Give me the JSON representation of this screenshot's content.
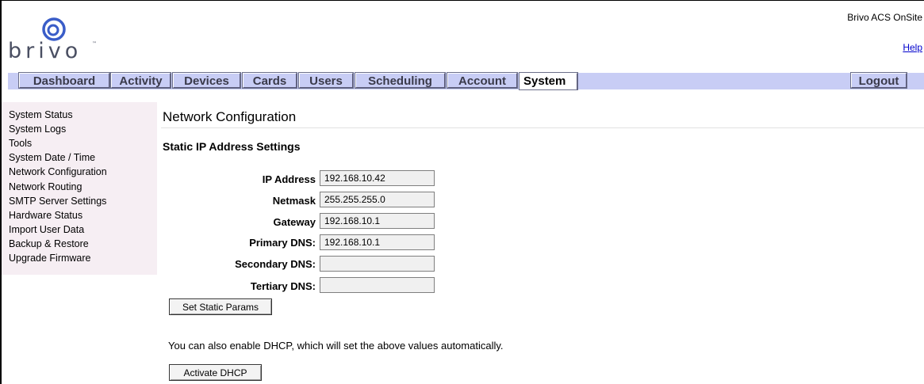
{
  "header": {
    "logo_text": "brivo",
    "logo_tm": "™",
    "product_name": "Brivo ACS OnSite",
    "help_link": "Help"
  },
  "nav": {
    "tabs": [
      {
        "label": "Dashboard"
      },
      {
        "label": "Activity"
      },
      {
        "label": "Devices"
      },
      {
        "label": "Cards"
      },
      {
        "label": "Users"
      },
      {
        "label": "Scheduling"
      },
      {
        "label": "Account"
      },
      {
        "label": "System",
        "active": true
      }
    ],
    "logout": "Logout"
  },
  "sidebar": {
    "items": [
      {
        "label": "System Status"
      },
      {
        "label": "System Logs"
      },
      {
        "label": "Tools"
      },
      {
        "label": "System Date / Time"
      },
      {
        "label": "Network Configuration"
      },
      {
        "label": "Network Routing"
      },
      {
        "label": "SMTP Server Settings"
      },
      {
        "label": "Hardware Status"
      },
      {
        "label": "Import User Data"
      },
      {
        "label": "Backup & Restore"
      },
      {
        "label": "Upgrade Firmware"
      }
    ]
  },
  "main": {
    "title": "Network Configuration",
    "section_title": "Static IP Address Settings",
    "fields": [
      {
        "label": "IP Address",
        "value": "192.168.10.42"
      },
      {
        "label": "Netmask",
        "value": "255.255.255.0"
      },
      {
        "label": "Gateway",
        "value": "192.168.10.1"
      },
      {
        "label": "Primary DNS:",
        "value": "192.168.10.1"
      },
      {
        "label": "Secondary DNS:",
        "value": ""
      },
      {
        "label": "Tertiary DNS:",
        "value": ""
      }
    ],
    "set_static_button": "Set Static Params",
    "dhcp_note": "You can also enable DHCP, which will set the above values automatically.",
    "activate_dhcp_button": "Activate DHCP"
  },
  "colors": {
    "nav_bg": "#c8cdf5",
    "sidebar_bg": "#f6eef3",
    "logo_blue": "#3a5dc8",
    "link": "#0000cc"
  }
}
